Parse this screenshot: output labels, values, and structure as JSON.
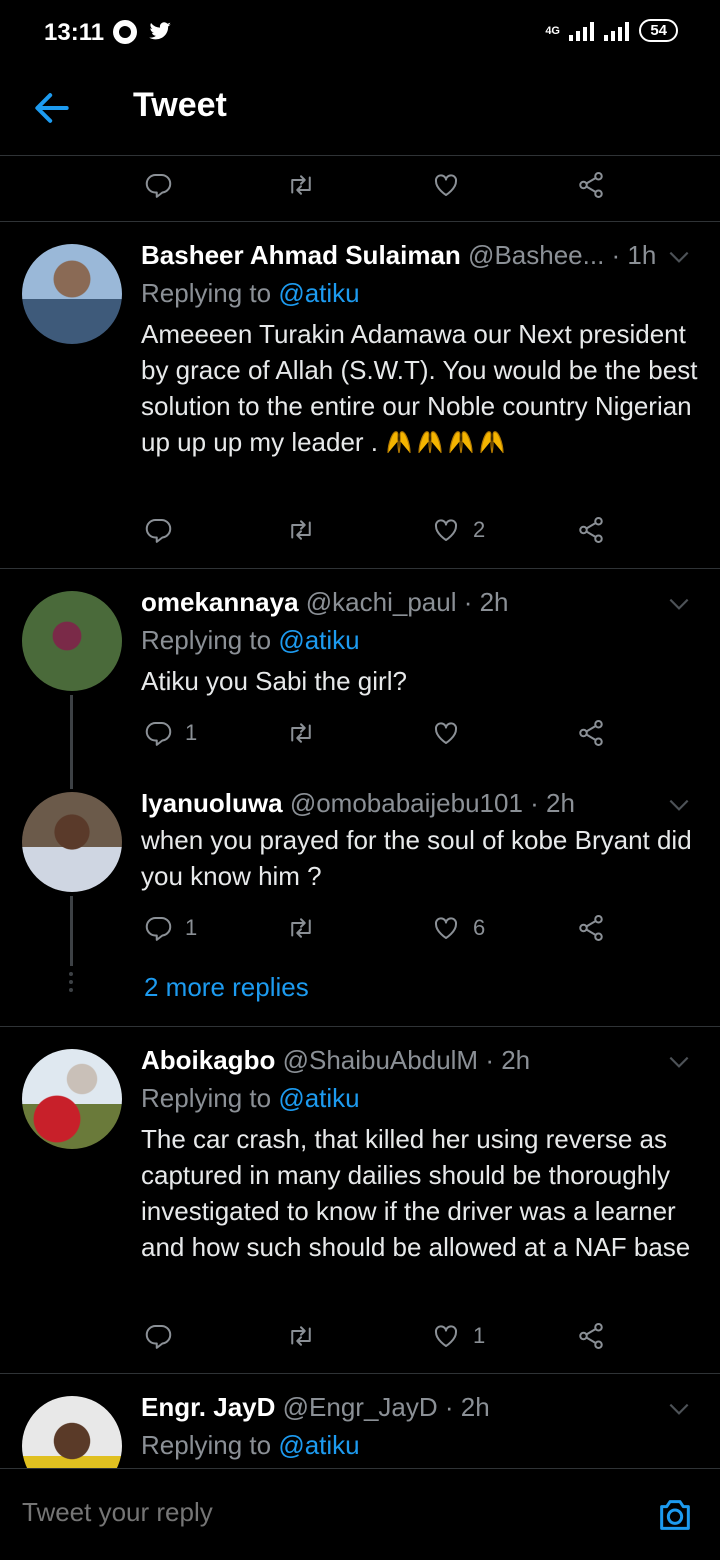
{
  "status": {
    "time": "13:11",
    "network": "4G",
    "battery": "54"
  },
  "header": {
    "title": "Tweet"
  },
  "main_actions": {
    "reply_count": "",
    "retweet_count": "",
    "like_count": ""
  },
  "tweets": [
    {
      "name": "Basheer Ahmad Sulaiman",
      "handle": "@Bashee...",
      "time": "· 1h",
      "replying_label": "Replying to",
      "replying_to": "@atiku",
      "text": "Ameeeen Turakin Adamawa our Next president by grace of Allah (S.W.T). You would be the best solution to the entire our Noble country Nigerian up up up my leader .",
      "reply_count": "",
      "retweet_count": "",
      "like_count": "2"
    },
    {
      "name": "omekannaya",
      "handle": "@kachi_paul",
      "time": "· 2h",
      "replying_label": "Replying to",
      "replying_to": "@atiku",
      "text": "Atiku you Sabi the girl?",
      "reply_count": "1",
      "retweet_count": "",
      "like_count": ""
    },
    {
      "name": "Iyanuoluwa",
      "handle": "@omobabaijebu101",
      "time": "· 2h",
      "text": "when you prayed for the soul of kobe Bryant did you know him ?",
      "reply_count": "1",
      "retweet_count": "",
      "like_count": "6"
    },
    {
      "name": "Aboikagbo",
      "handle": "@ShaibuAbdulM",
      "time": "· 2h",
      "replying_label": "Replying to",
      "replying_to": "@atiku",
      "text": "The car crash, that killed her using reverse as captured in many dailies should be thoroughly investigated to know if the driver was a learner and how such should be allowed at a NAF base",
      "reply_count": "",
      "retweet_count": "",
      "like_count": "1"
    },
    {
      "name": "Engr. JayD",
      "handle": "@Engr_JayD",
      "time": "· 2h",
      "replying_label": "Replying to",
      "replying_to": "@atiku"
    }
  ],
  "thread": {
    "more_replies": "2 more replies"
  },
  "reply_box": {
    "placeholder": "Tweet your reply"
  },
  "colors": {
    "accent": "#1d9bf0",
    "background": "#000000",
    "muted": "#8b9096"
  }
}
